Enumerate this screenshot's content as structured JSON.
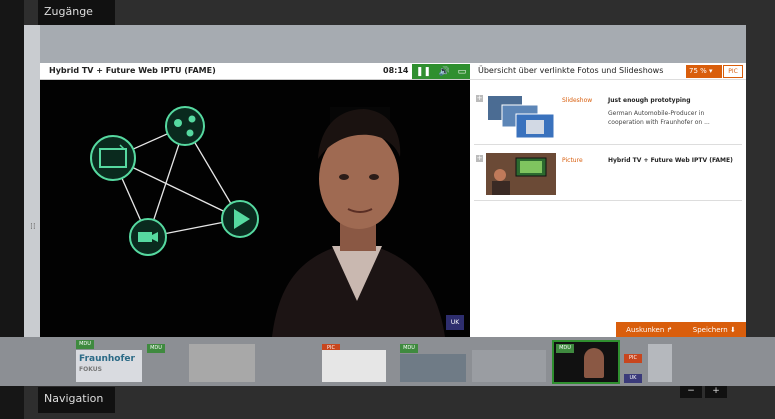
{
  "tabs": {
    "top": "Zugänge",
    "bottom": "Navigation"
  },
  "video": {
    "title": "Hybrid TV + Future Web IPTU (FAME)",
    "time": "08:14",
    "badge": "UK"
  },
  "sidepanel": {
    "title": "Übersicht über verlinkte Fotos und Slideshows",
    "zoom": "75 %",
    "pic_toggle": "PIC",
    "items": [
      {
        "kind": "Slideshow",
        "title": "Just enough prototyping",
        "desc": "German Automobile-Producer in cooperation with Fraunhofer on ..."
      },
      {
        "kind": "Picture",
        "title": "Hybrid TV + Future Web IPTV (FAME)"
      }
    ]
  },
  "actions": {
    "ask": "Auskunken",
    "save": "Speichern"
  },
  "filmstrip": {
    "items": [
      {
        "badges": [
          "MDU"
        ],
        "caption": "Fraunhofer",
        "sub": "FOKUS"
      },
      {
        "badges": [
          "MDU"
        ]
      },
      {
        "badges": [
          "PIC"
        ]
      },
      {
        "badges": [
          "MDU"
        ]
      },
      {
        "badges": [
          "MDU",
          "PIC",
          "UK"
        ]
      }
    ]
  },
  "zoom_controls": {
    "minus": "−",
    "plus": "+"
  },
  "colors": {
    "accent": "#d95e0c",
    "green": "#2f8f2f",
    "ring": "#56d9a0"
  }
}
